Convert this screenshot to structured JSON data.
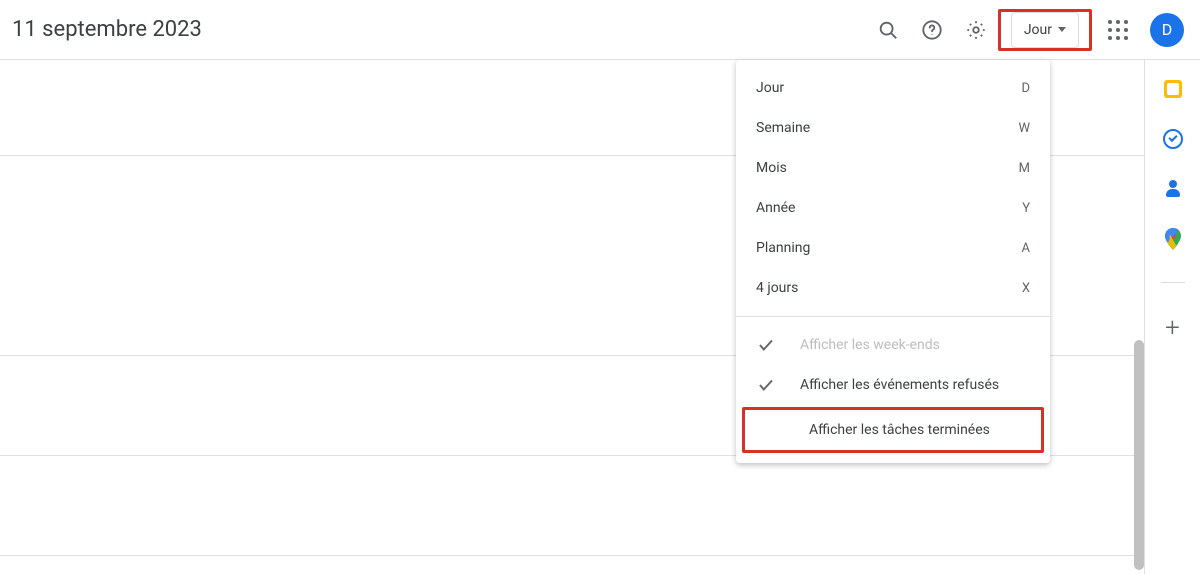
{
  "header": {
    "title": "11 septembre 2023",
    "view_button_label": "Jour",
    "avatar_letter": "D"
  },
  "dropdown": {
    "views": [
      {
        "label": "Jour",
        "shortcut": "D"
      },
      {
        "label": "Semaine",
        "shortcut": "W"
      },
      {
        "label": "Mois",
        "shortcut": "M"
      },
      {
        "label": "Année",
        "shortcut": "Y"
      },
      {
        "label": "Planning",
        "shortcut": "A"
      },
      {
        "label": "4 jours",
        "shortcut": "X"
      }
    ],
    "toggles": [
      {
        "label": "Afficher les week-ends",
        "checked": true,
        "disabled": true,
        "highlighted": false
      },
      {
        "label": "Afficher les événements refusés",
        "checked": true,
        "disabled": false,
        "highlighted": false
      },
      {
        "label": "Afficher les tâches terminées",
        "checked": false,
        "disabled": false,
        "highlighted": true
      }
    ]
  }
}
